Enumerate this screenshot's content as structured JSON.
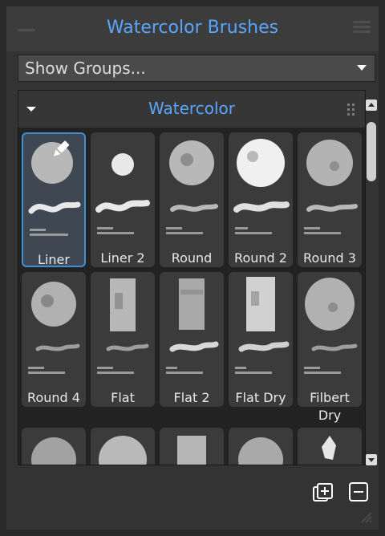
{
  "panel": {
    "title": "Watercolor Brushes",
    "dropdown_value": "Show Groups...",
    "group_title": "Watercolor"
  },
  "colors": {
    "accent": "#58a6ff",
    "background": "#2a2a2a",
    "panel": "#333333",
    "tile": "#3b3b3b",
    "selected_border": "#3f8fd6"
  },
  "brushes": [
    {
      "name": "Liner",
      "selected": true
    },
    {
      "name": "Liner 2",
      "selected": false
    },
    {
      "name": "Round",
      "selected": false
    },
    {
      "name": "Round 2",
      "selected": false
    },
    {
      "name": "Round 3",
      "selected": false
    },
    {
      "name": "Round 4",
      "selected": false
    },
    {
      "name": "Flat",
      "selected": false
    },
    {
      "name": "Flat 2",
      "selected": false
    },
    {
      "name": "Flat Dry",
      "selected": false
    },
    {
      "name": "Filbert Dry",
      "selected": false
    }
  ],
  "icons": {
    "menu": "hamburger-menu-icon",
    "handle": "drag-handle-icon",
    "add": "add-group-icon",
    "remove": "remove-icon",
    "resize": "resize-grip-icon",
    "dropdown": "chevron-down-icon",
    "collapse": "collapse-caret-icon",
    "grip": "grip-icon",
    "edit": "brush-edit-icon"
  }
}
